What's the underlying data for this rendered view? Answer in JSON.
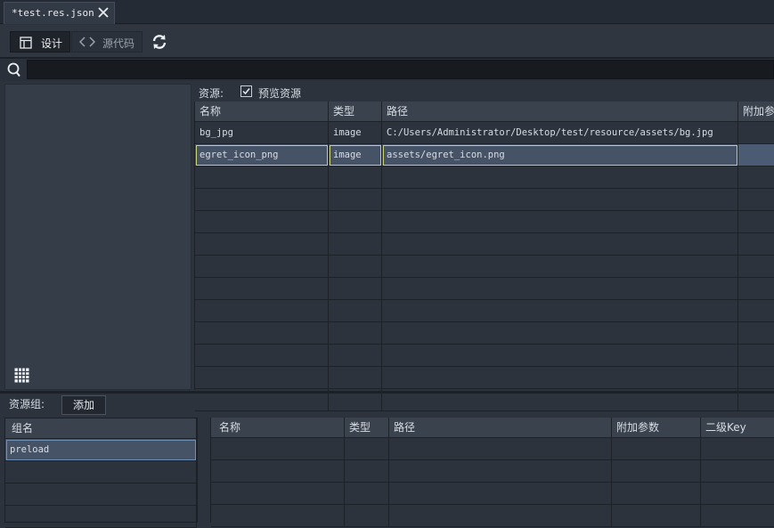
{
  "tab": {
    "title": "*test.res.json"
  },
  "toolbar": {
    "design_label": "设计",
    "source_label": "源代码"
  },
  "search": {
    "value": "",
    "placeholder": ""
  },
  "resources": {
    "label": "资源:",
    "preview_label": "预览资源",
    "preview_checked": true,
    "columns": [
      "名称",
      "类型",
      "路径",
      "附加参数"
    ],
    "rows": [
      {
        "name": "bg_jpg",
        "type": "image",
        "path": "C:/Users/Administrator/Desktop/test/resource/assets/bg.jpg",
        "extra": ""
      },
      {
        "name": "egret_icon_png",
        "type": "image",
        "path": "assets/egret_icon.png",
        "extra": ""
      }
    ]
  },
  "groups": {
    "label": "资源组:",
    "add_label": "添加",
    "column": "组名",
    "rows": [
      "preload"
    ]
  },
  "group_items": {
    "columns": [
      "名称",
      "类型",
      "路径",
      "附加参数",
      "二级Key"
    ]
  },
  "colors": {
    "accent_outline": "#c6d07a",
    "selection": "#465366",
    "background": "#2c333d"
  }
}
